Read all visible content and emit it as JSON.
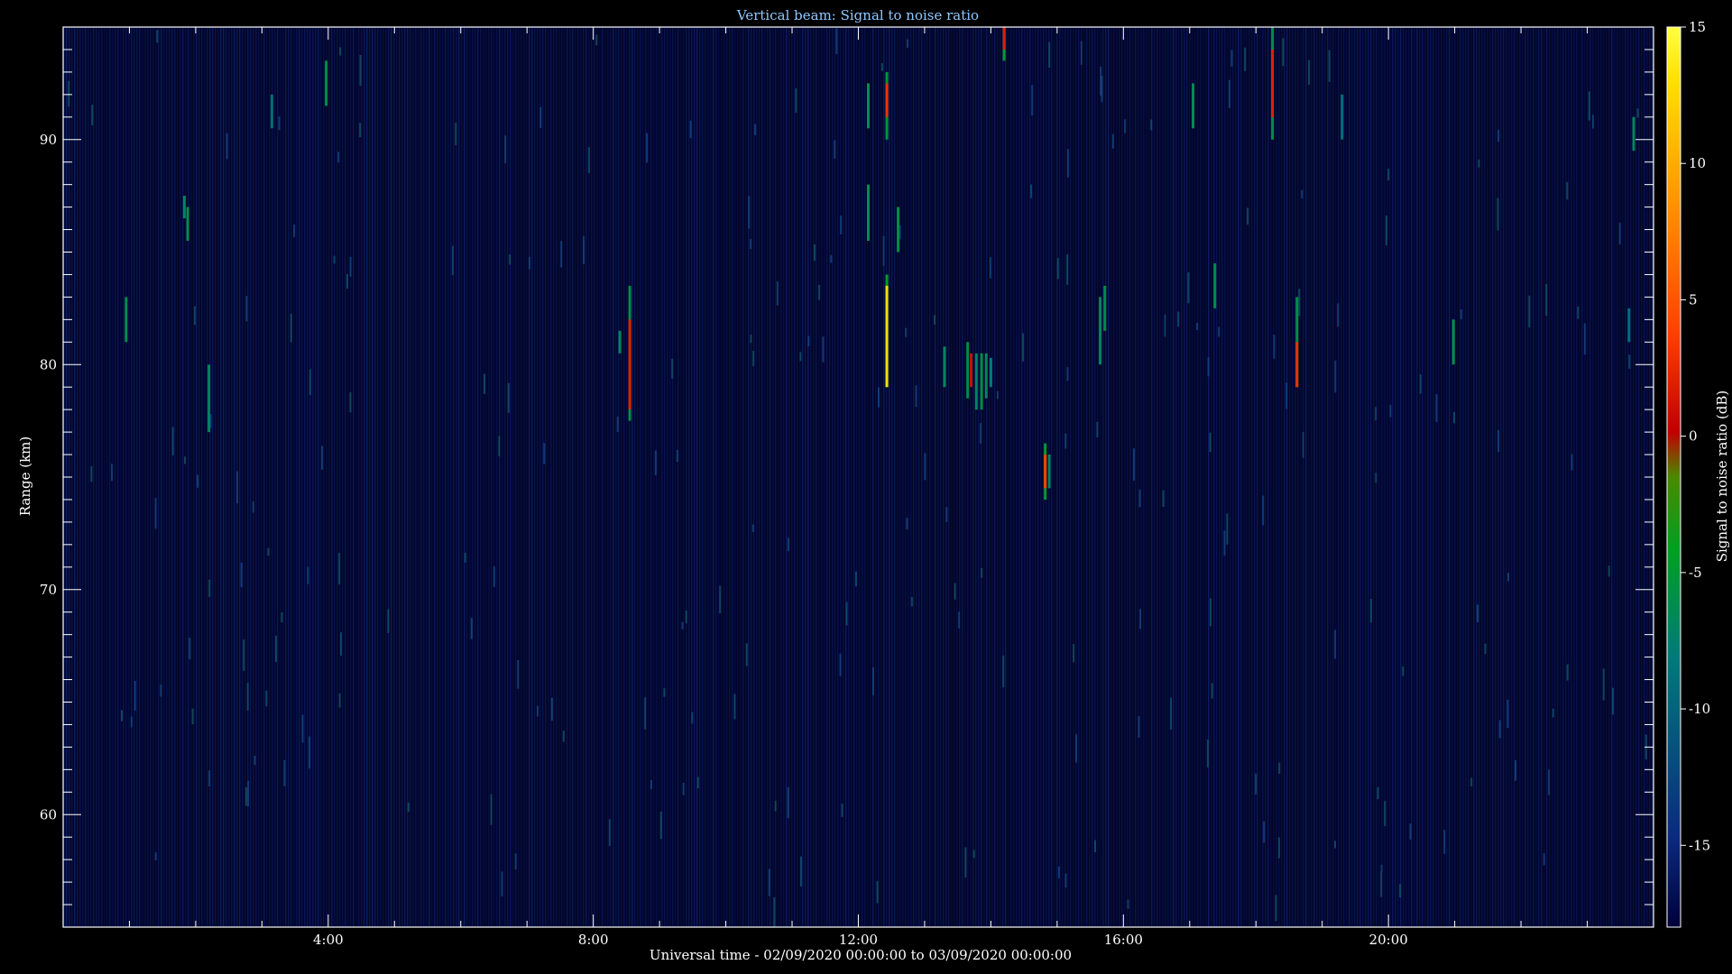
{
  "chart_data": {
    "type": "heatmap",
    "title": "Vertical beam: Signal to noise ratio",
    "xlabel": "Universal time - 02/09/2020 00:00:00 to 03/09/2020 00:00:00",
    "ylabel": "Range (km)",
    "colorbar_label": "Signal to noise ratio (dB)",
    "x_range_hours": [
      0,
      24
    ],
    "y_range_km": [
      55,
      95
    ],
    "color_range_db": [
      -18,
      15
    ],
    "x_ticks": [
      {
        "hour": 4,
        "label": "4:00"
      },
      {
        "hour": 8,
        "label": "8:00"
      },
      {
        "hour": 12,
        "label": "12:00"
      },
      {
        "hour": 16,
        "label": "16:00"
      },
      {
        "hour": 20,
        "label": "20:00"
      }
    ],
    "y_ticks": [
      {
        "km": 60,
        "label": "60"
      },
      {
        "km": 70,
        "label": "70"
      },
      {
        "km": 80,
        "label": "80"
      },
      {
        "km": 90,
        "label": "90"
      }
    ],
    "colorbar_ticks": [
      {
        "db": 15,
        "label": "15"
      },
      {
        "db": 10,
        "label": "10"
      },
      {
        "db": 5,
        "label": "5"
      },
      {
        "db": 0,
        "label": "0"
      },
      {
        "db": -5,
        "label": "-5"
      },
      {
        "db": -10,
        "label": "-10"
      },
      {
        "db": -15,
        "label": "-15"
      }
    ],
    "colormap": [
      "#00003a",
      "#0b2a80",
      "#007a7a",
      "#00a020",
      "#4a8a00",
      "#c00000",
      "#ff4000",
      "#ff9000",
      "#ffe000",
      "#ffff40"
    ],
    "background_noise_db": -16,
    "echoes": [
      {
        "hour": 0.95,
        "km_from": 81.0,
        "km_to": 83.0,
        "db": -6
      },
      {
        "hour": 1.83,
        "km_from": 86.5,
        "km_to": 87.5,
        "db": -7
      },
      {
        "hour": 1.88,
        "km_from": 85.5,
        "km_to": 87.0,
        "db": -6
      },
      {
        "hour": 2.2,
        "km_from": 77.0,
        "km_to": 80.0,
        "db": -7
      },
      {
        "hour": 3.15,
        "km_from": 90.5,
        "km_to": 92.0,
        "db": -9
      },
      {
        "hour": 3.97,
        "km_from": 91.5,
        "km_to": 93.5,
        "db": -6
      },
      {
        "hour": 8.4,
        "km_from": 80.5,
        "km_to": 81.5,
        "db": -7
      },
      {
        "hour": 8.55,
        "km_from": 77.5,
        "km_to": 83.5,
        "db": -6
      },
      {
        "hour": 8.55,
        "km_from": 78.0,
        "km_to": 82.0,
        "db": 2
      },
      {
        "hour": 12.15,
        "km_from": 90.5,
        "km_to": 92.5,
        "db": -6
      },
      {
        "hour": 12.15,
        "km_from": 85.5,
        "km_to": 88.0,
        "db": -6
      },
      {
        "hour": 12.43,
        "km_from": 90.0,
        "km_to": 93.0,
        "db": -5
      },
      {
        "hour": 12.43,
        "km_from": 91.0,
        "km_to": 92.5,
        "db": 3
      },
      {
        "hour": 12.43,
        "km_from": 79.0,
        "km_to": 84.0,
        "db": -4
      },
      {
        "hour": 12.43,
        "km_from": 79.0,
        "km_to": 83.5,
        "db": 13
      },
      {
        "hour": 12.6,
        "km_from": 85.0,
        "km_to": 87.0,
        "db": -6
      },
      {
        "hour": 13.3,
        "km_from": 79.0,
        "km_to": 80.8,
        "db": -7
      },
      {
        "hour": 13.65,
        "km_from": 78.5,
        "km_to": 81.0,
        "db": -6
      },
      {
        "hour": 13.7,
        "km_from": 79.0,
        "km_to": 80.5,
        "db": 1
      },
      {
        "hour": 13.78,
        "km_from": 78.0,
        "km_to": 80.5,
        "db": -7
      },
      {
        "hour": 13.86,
        "km_from": 78.0,
        "km_to": 80.5,
        "db": -6
      },
      {
        "hour": 13.93,
        "km_from": 78.5,
        "km_to": 80.5,
        "db": -7
      },
      {
        "hour": 14.0,
        "km_from": 79.0,
        "km_to": 80.3,
        "db": -8
      },
      {
        "hour": 14.2,
        "km_from": 93.5,
        "km_to": 95.0,
        "db": -5
      },
      {
        "hour": 14.2,
        "km_from": 94.0,
        "km_to": 95.0,
        "db": 2
      },
      {
        "hour": 14.82,
        "km_from": 74.0,
        "km_to": 76.5,
        "db": -5
      },
      {
        "hour": 14.82,
        "km_from": 74.5,
        "km_to": 76.0,
        "db": 4
      },
      {
        "hour": 14.88,
        "km_from": 74.5,
        "km_to": 76.0,
        "db": -7
      },
      {
        "hour": 15.65,
        "km_from": 80.0,
        "km_to": 83.0,
        "db": -7
      },
      {
        "hour": 15.72,
        "km_from": 81.5,
        "km_to": 83.5,
        "db": -6
      },
      {
        "hour": 17.05,
        "km_from": 90.5,
        "km_to": 92.5,
        "db": -6
      },
      {
        "hour": 17.38,
        "km_from": 82.5,
        "km_to": 84.5,
        "db": -6
      },
      {
        "hour": 18.25,
        "km_from": 90.0,
        "km_to": 95.0,
        "db": -6
      },
      {
        "hour": 18.25,
        "km_from": 91.0,
        "km_to": 94.0,
        "db": 2
      },
      {
        "hour": 18.62,
        "km_from": 79.0,
        "km_to": 83.0,
        "db": -6
      },
      {
        "hour": 18.62,
        "km_from": 79.0,
        "km_to": 81.0,
        "db": 3
      },
      {
        "hour": 19.3,
        "km_from": 90.0,
        "km_to": 92.0,
        "db": -9
      },
      {
        "hour": 20.98,
        "km_from": 80.0,
        "km_to": 82.0,
        "db": -6
      },
      {
        "hour": 23.7,
        "km_from": 89.5,
        "km_to": 91.0,
        "db": -7
      },
      {
        "hour": 23.63,
        "km_from": 81.0,
        "km_to": 82.5,
        "db": -9
      }
    ]
  }
}
